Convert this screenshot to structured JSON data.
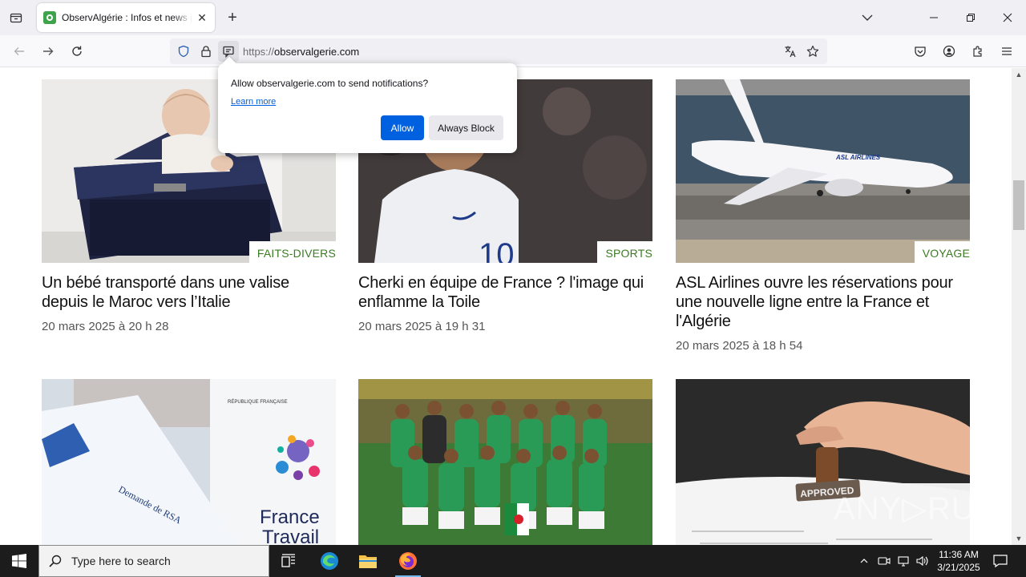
{
  "browser": {
    "tab": {
      "title": "ObservAlgérie : Infos et news pour l'Algérie",
      "close": "✕"
    },
    "new_tab": "+",
    "url": {
      "scheme": "https://",
      "host": "observalgerie.com"
    }
  },
  "notification": {
    "message": "Allow observalgerie.com to send notifications?",
    "learn_more": "Learn more",
    "allow": "Allow",
    "block": "Always Block"
  },
  "articles": [
    {
      "category": "FAITS-DIVERS",
      "title": "Un bébé transporté dans une valise depuis le Maroc vers l’Italie",
      "date": "20 mars 2025 à 20 h 28"
    },
    {
      "category": "SPORTS",
      "title": "Cherki en équipe de France ? l'image qui enflamme la Toile",
      "date": "20 mars 2025 à 19 h 31"
    },
    {
      "category": "VOYAGE",
      "title": "ASL Airlines ouvre les réservations pour une nouvelle ligne entre la France et l'Algérie",
      "date": "20 mars 2025 à 18 h 54"
    },
    {
      "category": "",
      "title": "",
      "date": ""
    },
    {
      "category": "",
      "title": "",
      "date": ""
    },
    {
      "category": "",
      "title": "",
      "date": ""
    }
  ],
  "image_text": {
    "rsa_form": "Demande de RSA",
    "republique": "RÉPUBLIQUE FRANÇAISE",
    "france_travail_1": "France",
    "france_travail_2": "Travail",
    "stamp": "APPROVED",
    "plane_livery": "ASL AIRLINES"
  },
  "watermark": "ANY▷RUN",
  "taskbar": {
    "search_placeholder": "Type here to search",
    "time": "11:36 AM",
    "date": "3/21/2025"
  },
  "colors": {
    "category": "#3b7b22",
    "allow_button": "#0061e0",
    "taskbar": "#1c1c1c"
  }
}
